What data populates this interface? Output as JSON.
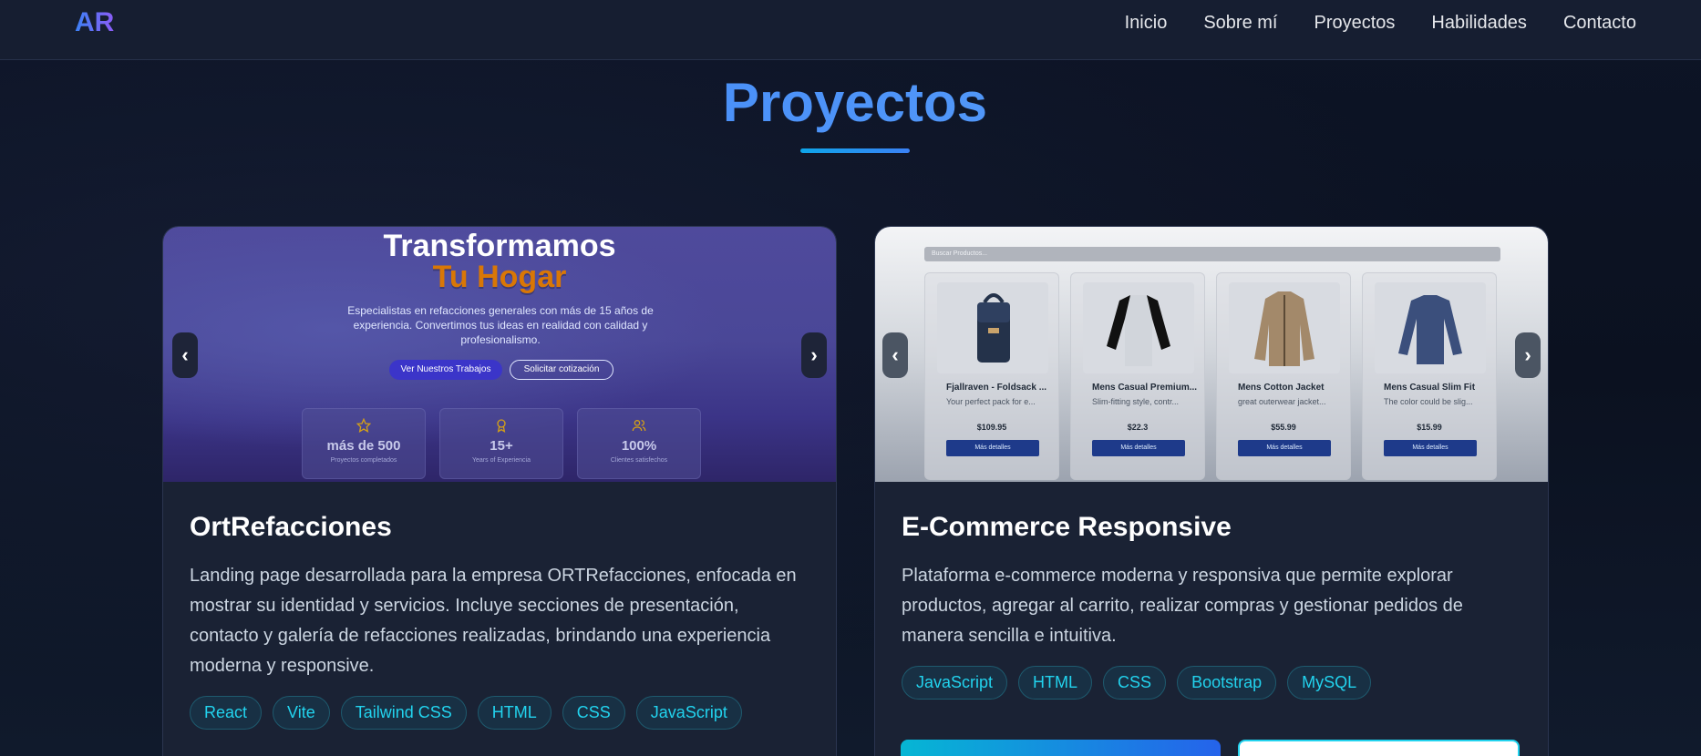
{
  "nav": {
    "logo": "AR",
    "links": [
      "Inicio",
      "Sobre mí",
      "Proyectos",
      "Habilidades",
      "Contacto"
    ]
  },
  "section": {
    "title": "Proyectos"
  },
  "projects": [
    {
      "title": "OrtRefacciones",
      "description": "Landing page desarrollada para la empresa ORTRefacciones, enfocada en mostrar su identidad y servicios. Incluye secciones de presentación, contacto y galería de refacciones realizadas, brindando una experiencia moderna y responsive.",
      "tags": [
        "React",
        "Vite",
        "Tailwind CSS",
        "HTML",
        "CSS",
        "JavaScript"
      ],
      "preview": {
        "heading_line1": "Transformamos",
        "heading_line2": "Tu Hogar",
        "description": "Especialistas en refacciones generales con más de 15 años de experiencia. Convertimos tus ideas en realidad con calidad y profesionalismo.",
        "primary_button": "Ver Nuestros Trabajos",
        "secondary_button": "Solicitar cotización",
        "stats": [
          {
            "icon": "star-icon",
            "value": "más de 500",
            "label": "Proyectos completados"
          },
          {
            "icon": "award-icon",
            "value": "15+",
            "label": "Years of Experiencia"
          },
          {
            "icon": "users-icon",
            "value": "100%",
            "label": "Clientes satisfechos"
          }
        ]
      },
      "carousel": {
        "prev": "‹",
        "next": "›"
      }
    },
    {
      "title": "E-Commerce Responsive",
      "description": "Plataforma e-commerce moderna y responsiva que permite explorar productos, agregar al carrito, realizar compras y gestionar pedidos de manera sencilla e intuitiva.",
      "tags": [
        "JavaScript",
        "HTML",
        "CSS",
        "Bootstrap",
        "MySQL"
      ],
      "preview": {
        "search_placeholder": "Buscar Productos...",
        "products": [
          {
            "name": "Fjallraven - Foldsack ...",
            "desc": "Your perfect pack for e...",
            "price": "$109.95",
            "button": "Más detalles",
            "image": "backpack"
          },
          {
            "name": "Mens Casual Premium...",
            "desc": "Slim-fitting style, contr...",
            "price": "$22.3",
            "button": "Más detalles",
            "image": "raglan-shirt"
          },
          {
            "name": "Mens Cotton Jacket",
            "desc": "great outerwear jacket...",
            "price": "$55.99",
            "button": "Más detalles",
            "image": "jacket"
          },
          {
            "name": "Mens Casual Slim Fit",
            "desc": "The color could be slig...",
            "price": "$15.99",
            "button": "Más detalles",
            "image": "long-sleeve-shirt"
          }
        ]
      },
      "carousel": {
        "prev": "‹",
        "next": "›"
      }
    }
  ],
  "colors": {
    "accent_blue": "#3b82f6",
    "accent_cyan": "#22d3ee",
    "card_bg": "#1a2234",
    "page_bg": "#0c1222"
  }
}
